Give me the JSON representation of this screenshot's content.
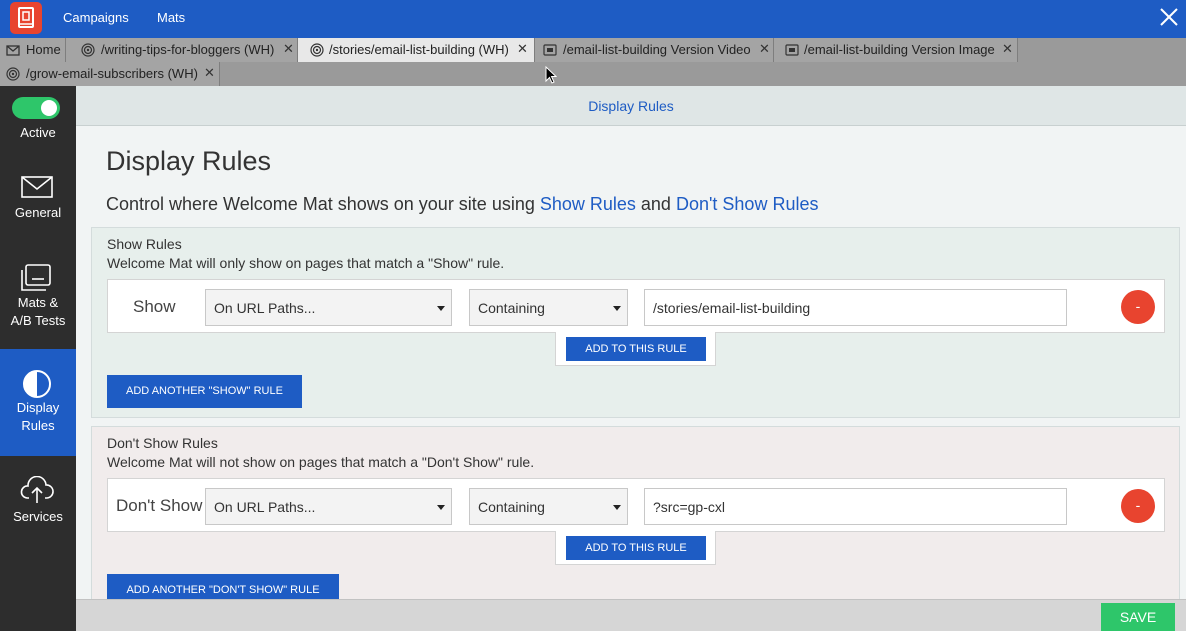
{
  "topbar": {
    "nav": [
      "Campaigns",
      "Mats"
    ],
    "logo_icon": "welcome-mat-logo-icon",
    "close_icon": "close-icon"
  },
  "tabs": [
    {
      "label": "Home",
      "icon": "mail-icon",
      "closable": false
    },
    {
      "label": "/writing-tips-for-bloggers (WH)",
      "icon": "target-icon",
      "closable": true
    },
    {
      "label": "/stories/email-list-building (WH)",
      "icon": "target-icon",
      "closable": true,
      "active": true
    },
    {
      "label": "/email-list-building Version Video",
      "icon": "mat-icon",
      "closable": true
    },
    {
      "label": "/email-list-building Version Image",
      "icon": "mat-icon",
      "closable": true
    },
    {
      "label": "/grow-email-subscribers (WH)",
      "icon": "target-icon",
      "closable": true
    }
  ],
  "tab_close": "✕",
  "sidebar": {
    "items": [
      {
        "label": "Active",
        "icon": "toggle-on"
      },
      {
        "label": "General",
        "icon": "envelope-icon"
      },
      {
        "label": "Mats &\nA/B Tests",
        "icon": "mats-icon"
      },
      {
        "label": "Display\nRules",
        "icon": "half-circle-icon",
        "active": true
      },
      {
        "label": "Services",
        "icon": "cloud-upload-icon"
      }
    ]
  },
  "header": {
    "title": "Display Rules"
  },
  "page": {
    "title": "Display Rules",
    "desc_prefix": "Control where Welcome Mat shows on your site using ",
    "desc_link1": "Show Rules",
    "desc_and": " and ",
    "desc_link2": "Don't Show Rules"
  },
  "show_rules": {
    "title": "Show Rules",
    "desc": "Welcome Mat will only show on pages that match a \"Show\" rule.",
    "rule_label": "Show",
    "condition": "On URL Paths...",
    "operator": "Containing",
    "value": "/stories/email-list-building",
    "remove_label": "-",
    "add_to_rule": "ADD TO THIS RULE",
    "add_another": "ADD ANOTHER \"SHOW\" RULE"
  },
  "dont_show_rules": {
    "title": "Don't Show Rules",
    "desc": "Welcome Mat will not show on pages that match a \"Don't Show\" rule.",
    "rule_label": "Don't Show",
    "condition": "On URL Paths...",
    "operator": "Containing",
    "value": "?src=gp-cxl",
    "remove_label": "-",
    "add_to_rule": "ADD TO THIS RULE",
    "add_another": "ADD ANOTHER \"DON'T SHOW\" RULE"
  },
  "footer": {
    "save_label": "SAVE"
  },
  "colors": {
    "brand_blue": "#1e5cc4",
    "accent_red": "#e8442f",
    "save_green": "#2ec66a"
  }
}
